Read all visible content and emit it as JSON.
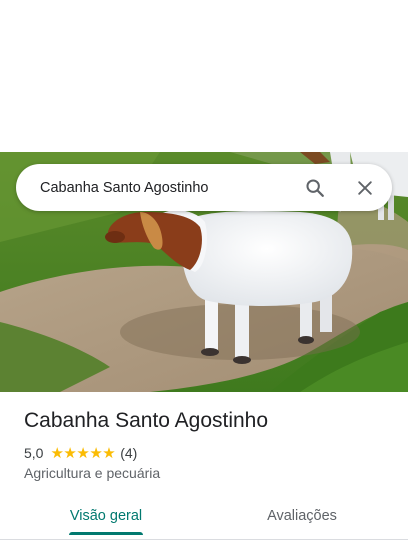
{
  "search": {
    "value": "Cabanha Santo Agostinho"
  },
  "place": {
    "name": "Cabanha Santo Agostinho",
    "rating": "5,0",
    "stars": 5,
    "review_count": "(4)",
    "category": "Agricultura e pecuária"
  },
  "tabs": [
    {
      "label": "Visão geral",
      "active": true
    },
    {
      "label": "Avaliações",
      "active": false
    }
  ],
  "colors": {
    "accent": "#01796f",
    "star": "#fbbc04"
  },
  "icons": {
    "search": "search-icon",
    "close": "close-icon"
  }
}
